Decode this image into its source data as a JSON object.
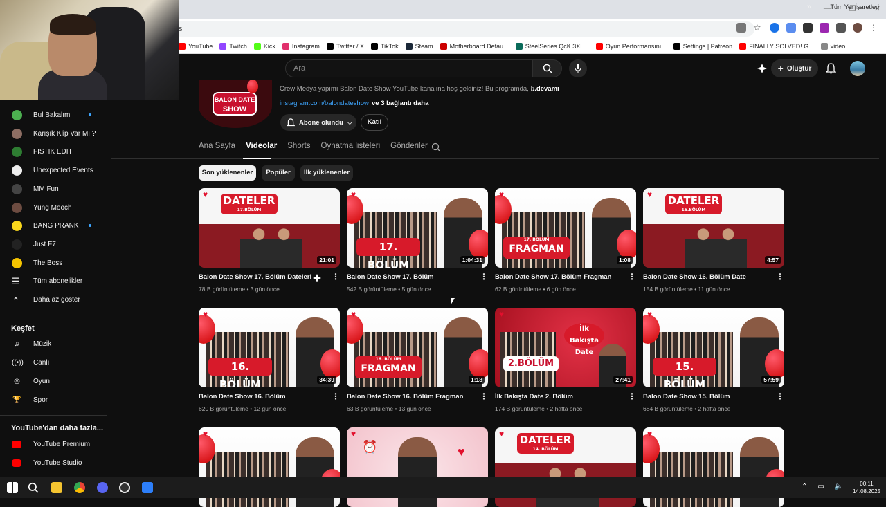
{
  "browser": {
    "omnibox_text": "s",
    "bookmarks": [
      {
        "label": "YouTube",
        "color": "#ff0000"
      },
      {
        "label": "Twitch",
        "color": "#9146ff"
      },
      {
        "label": "Kick",
        "color": "#53fc18"
      },
      {
        "label": "Instagram",
        "color": "#e1306c"
      },
      {
        "label": "Twitter / X",
        "color": "#000000"
      },
      {
        "label": "TikTok",
        "color": "#000000"
      },
      {
        "label": "Steam",
        "color": "#1b2838"
      },
      {
        "label": "Motherboard Defau...",
        "color": "#cc0000"
      },
      {
        "label": "SteelSeries QcK 3XL...",
        "color": "#0a6b5a"
      },
      {
        "label": "Oyun Performansını...",
        "color": "#ff0000"
      },
      {
        "label": "Settings | Patreon",
        "color": "#000000"
      },
      {
        "label": "FINALLY SOLVED! G...",
        "color": "#ff0000"
      },
      {
        "label": "video",
        "color": "#888888"
      }
    ],
    "more_bookmarks": "»",
    "all_bookmarks": "Tüm Yer İşaretleri"
  },
  "youtube": {
    "search_placeholder": "Ara",
    "create_label": "Oluştur"
  },
  "sidebar": {
    "subscriptions": [
      {
        "label": "Bul Bakalım",
        "color": "#4caf50",
        "dot": true
      },
      {
        "label": "Karışık Klip Var Mı ?",
        "color": "#8d6e63",
        "dot": false
      },
      {
        "label": "FISTIK EDIT",
        "color": "#2e7d32",
        "dot": false
      },
      {
        "label": "Unexpected Events",
        "color": "#eeeeee",
        "dot": false
      },
      {
        "label": "MM Fun",
        "color": "#444444",
        "dot": false
      },
      {
        "label": "Yung Mooch",
        "color": "#6d4c41",
        "dot": false
      },
      {
        "label": "BANG PRANK",
        "color": "#f9d71c",
        "dot": true
      },
      {
        "label": "Just F7",
        "color": "#222222",
        "dot": false
      },
      {
        "label": "The Boss",
        "color": "#f5c400",
        "dot": false
      },
      {
        "label": "Tüm abonelikler",
        "color": "",
        "dot": false
      },
      {
        "label": "Daha az göster",
        "color": "",
        "dot": false
      }
    ],
    "explore_title": "Keşfet",
    "explore": [
      {
        "label": "Müzik",
        "icon": "music-icon"
      },
      {
        "label": "Canlı",
        "icon": "live-icon"
      },
      {
        "label": "Oyun",
        "icon": "gaming-icon"
      },
      {
        "label": "Spor",
        "icon": "trophy-icon"
      }
    ],
    "more_title": "YouTube'dan daha fazla...",
    "more": [
      {
        "label": "YouTube Premium"
      },
      {
        "label": "YouTube Studio"
      }
    ]
  },
  "channel": {
    "logo_line1": "BALON DATE",
    "logo_line2": "SHOW",
    "description": "Crew Medya yapımı Balon Date Show YouTube kanalına hoş geldiniz! Bu programda, b",
    "more": "...devamı",
    "link": "instagram.com/balondateshow",
    "link_more": "ve 3 bağlantı daha",
    "subscribe_label": "Abone olundu",
    "join_label": "Katıl",
    "tabs": [
      "Ana Sayfa",
      "Videolar",
      "Shorts",
      "Oynatma listeleri",
      "Gönderiler"
    ],
    "active_tab": "Videolar",
    "chips": [
      "Son yüklenenler",
      "Popüler",
      "İlk yüklenenler"
    ]
  },
  "videos": [
    {
      "title": "Balon Date Show 17. Bölüm Dateleri",
      "meta": "78 B görüntüleme • 3 gün önce",
      "duration": "21:01",
      "thumb_text": "DATELER",
      "thumb_sub": "17.BÖLÜM"
    },
    {
      "title": "Balon Date Show 17. Bölüm",
      "meta": "542 B görüntüleme • 5 gün önce",
      "duration": "1:04:31",
      "thumb_text": "17. BÖLÜM",
      "thumb_sub": ""
    },
    {
      "title": "Balon Date Show 17. Bölüm Fragman",
      "meta": "62 B görüntüleme • 6 gün önce",
      "duration": "1:08",
      "thumb_text": "FRAGMAN",
      "thumb_sub": "17. BÖLÜM"
    },
    {
      "title": "Balon Date Show 16. Bölüm Date",
      "meta": "154 B görüntüleme • 11 gün önce",
      "duration": "4:57",
      "thumb_text": "DATELER",
      "thumb_sub": "16.BÖLÜM"
    },
    {
      "title": "Balon Date Show 16. Bölüm",
      "meta": "620 B görüntüleme • 12 gün önce",
      "duration": "34:39",
      "thumb_text": "16. BÖLÜM",
      "thumb_sub": ""
    },
    {
      "title": "Balon Date Show 16. Bölüm Fragman",
      "meta": "63 B görüntüleme • 13 gün önce",
      "duration": "1:18",
      "thumb_text": "FRAGMAN",
      "thumb_sub": "16. BÖLÜM"
    },
    {
      "title": "İlk Bakışta Date 2. Bölüm",
      "meta": "174 B görüntüleme • 2 hafta önce",
      "duration": "27:41",
      "thumb_text": "2.BÖLÜM",
      "thumb_sub": "İlk Bakışta Date"
    },
    {
      "title": "Balon Date Show 15. Bölüm",
      "meta": "684 B görüntüleme • 2 hafta önce",
      "duration": "57:59",
      "thumb_text": "15. BÖLÜM",
      "thumb_sub": ""
    },
    {
      "title": "",
      "meta": "",
      "duration": "",
      "thumb_text": "",
      "thumb_sub": ""
    },
    {
      "title": "",
      "meta": "",
      "duration": "",
      "thumb_text": "",
      "thumb_sub": ""
    },
    {
      "title": "",
      "meta": "",
      "duration": "",
      "thumb_text": "DATELER",
      "thumb_sub": "14. BÖLÜM"
    },
    {
      "title": "",
      "meta": "",
      "duration": "",
      "thumb_text": "",
      "thumb_sub": ""
    }
  ],
  "taskbar": {
    "time": "00:11",
    "date": "14.08.2025"
  }
}
